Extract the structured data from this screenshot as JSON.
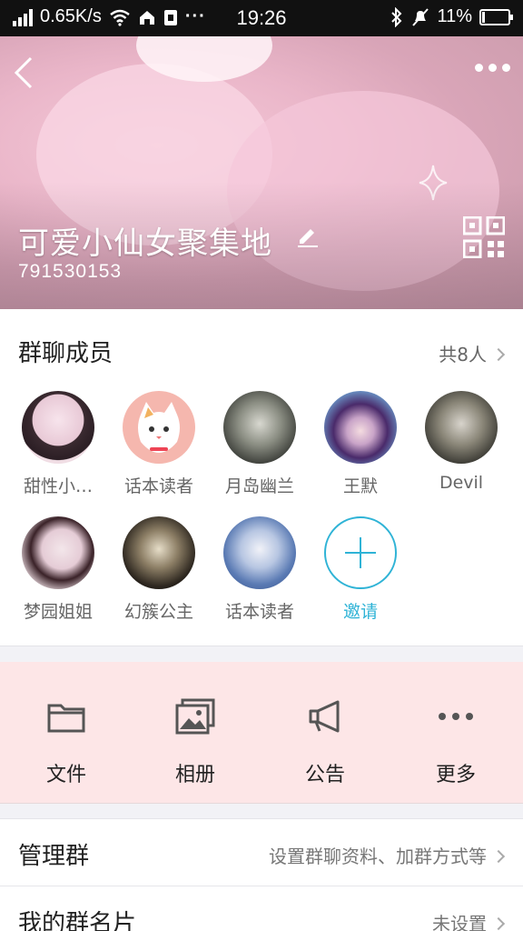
{
  "status_bar": {
    "net_speed": "0.65K/s",
    "time": "19:26",
    "battery": "11%",
    "battery_level": 0.11,
    "icons": [
      "signal-icon",
      "wifi-icon",
      "home-icon",
      "sim-icon",
      "more-icon",
      "bluetooth-icon",
      "mute-icon",
      "battery-icon"
    ]
  },
  "header": {
    "group_name": "可爱小仙女聚集地",
    "group_id": "791530153"
  },
  "members": {
    "title": "群聊成员",
    "count_label": "共8人",
    "list": [
      {
        "name": "甜性小…"
      },
      {
        "name": "话本读者"
      },
      {
        "name": "月岛幽兰"
      },
      {
        "name": "王默"
      },
      {
        "name": "Devil"
      },
      {
        "name": "梦园姐姐"
      },
      {
        "name": "幻簇公主"
      },
      {
        "name": "话本读者"
      }
    ],
    "invite_label": "邀请"
  },
  "actions": [
    {
      "label": "文件",
      "icon": "folder-icon"
    },
    {
      "label": "相册",
      "icon": "album-icon"
    },
    {
      "label": "公告",
      "icon": "announcement-icon"
    },
    {
      "label": "更多",
      "icon": "more-icon"
    }
  ],
  "rows": {
    "manage": {
      "label": "管理群",
      "value": "设置群聊资料、加群方式等"
    },
    "card": {
      "label": "我的群名片",
      "value": "未设置"
    }
  },
  "colors": {
    "accent": "#2fb3d6",
    "action_bg": "#fde6e7"
  }
}
